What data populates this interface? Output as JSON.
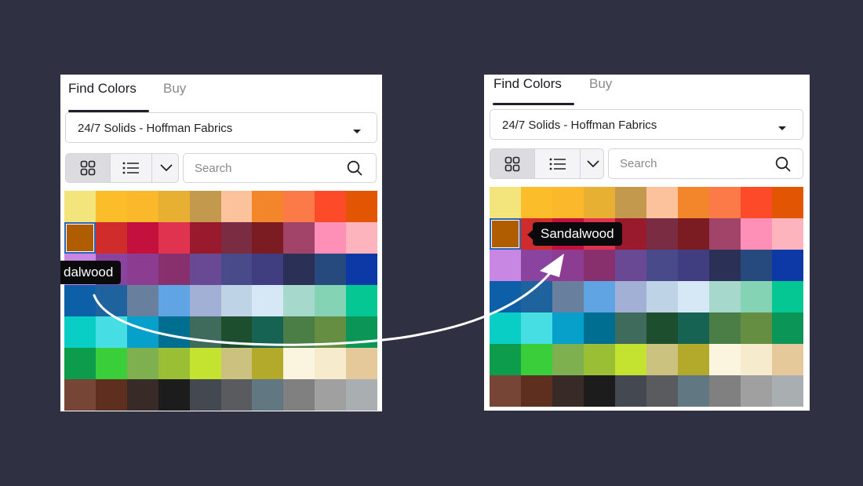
{
  "panels": [
    {
      "tabs": [
        {
          "label": "Find Colors",
          "active": true
        },
        {
          "label": "Buy",
          "active": false
        }
      ],
      "collection": "24/7 Solids - Hoffman Fabrics",
      "view_modes": [
        {
          "icon": "grid-icon",
          "active": true
        },
        {
          "icon": "list-icon",
          "active": false
        },
        {
          "icon": "chevron-down-icon",
          "active": false
        }
      ],
      "search": {
        "placeholder": "Search",
        "icon": "search-icon"
      },
      "tooltip": {
        "text": "dalwood"
      },
      "selected_swatch": 10
    },
    {
      "tabs": [
        {
          "label": "Find Colors",
          "active": true
        },
        {
          "label": "Buy",
          "active": false
        }
      ],
      "collection": "24/7 Solids - Hoffman Fabrics",
      "view_modes": [
        {
          "icon": "grid-icon",
          "active": true
        },
        {
          "icon": "list-icon",
          "active": false
        },
        {
          "icon": "chevron-down-icon",
          "active": false
        }
      ],
      "search": {
        "placeholder": "Search",
        "icon": "search-icon"
      },
      "tooltip": {
        "text": "Sandalwood"
      },
      "selected_swatch": 10
    }
  ],
  "swatches": [
    "#f3e57c",
    "#fbbd2a",
    "#fbb82a",
    "#e8b032",
    "#c39a4d",
    "#fcc29c",
    "#f3862b",
    "#fb7a48",
    "#fd4a28",
    "#e25502",
    "#b05c00",
    "#d12c2c",
    "#c4103d",
    "#e0334f",
    "#9a1a2d",
    "#7a2d42",
    "#7a1c22",
    "#a2446a",
    "#fe90b7",
    "#fdb4bc",
    "#c987e4",
    "#8a44a0",
    "#8c3d92",
    "#882f6e",
    "#6a4994",
    "#494a8a",
    "#403d80",
    "#2a3056",
    "#274a7e",
    "#0c39a6",
    "#0d5fa8",
    "#1f639e",
    "#687f9e",
    "#61a4e4",
    "#a3b0d6",
    "#bfd3e6",
    "#d6e7f6",
    "#a6d8cc",
    "#83d3b4",
    "#04c794",
    "#08cec6",
    "#46dee2",
    "#06a0ca",
    "#006e90",
    "#3f6b5c",
    "#1d4e2e",
    "#166354",
    "#4a7e46",
    "#658e42",
    "#0b9557",
    "#0d9b4c",
    "#3bce3b",
    "#7eb050",
    "#9abf34",
    "#c3e330",
    "#ccc27f",
    "#b3aa2b",
    "#fbf5e0",
    "#f6ebcc",
    "#e5c99a",
    "#764536",
    "#5e2e1e",
    "#372a27",
    "#1c1c1c",
    "#444850",
    "#5a5b5e",
    "#617883",
    "#808080",
    "#a0a0a0",
    "#a9afb0"
  ]
}
